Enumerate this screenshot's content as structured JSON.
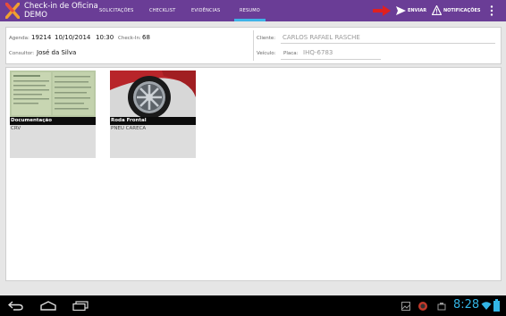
{
  "app": {
    "title_line1": "Check-in de Oficina",
    "title_line2": "DEMO",
    "bar_color": "#6a3d96"
  },
  "tabs": [
    {
      "label": "SOLICITAÇÕES"
    },
    {
      "label": "CHECKLIST"
    },
    {
      "label": "EVIDÊNCIAS"
    },
    {
      "label": "RESUMO",
      "active": true
    }
  ],
  "actions": {
    "enviar": "ENVIAR",
    "notificacoes": "NOTIFICAÇÕES"
  },
  "info": {
    "agenda_label": "Agenda:",
    "agenda_number": "19214",
    "agenda_date": "10/10/2014",
    "agenda_time": "10:30",
    "checkin_label": "Check-In:",
    "checkin_value": "68",
    "consultor_label": "Consultor:",
    "consultor_value": "José da Silva",
    "cliente_label": "Cliente:",
    "cliente_value": "CARLOS RAFAEL RASCHE",
    "veiculo_label": "Veículo:",
    "placa_label": "Placa:",
    "placa_value": "IHQ-6783"
  },
  "cards": [
    {
      "title": "Documentação",
      "description": "CRV"
    },
    {
      "title": "Roda Frontal",
      "description": "PNEU CARECA"
    }
  ],
  "system": {
    "time": "8:28"
  },
  "icons": [
    "app-logo-icon",
    "red-arrow-icon",
    "send-icon",
    "warning-icon",
    "overflow-menu-icon",
    "back-icon",
    "home-icon",
    "recent-apps-icon",
    "gallery-icon",
    "usb-icon",
    "wifi-icon",
    "battery-icon"
  ],
  "colors": {
    "accent": "#3fb3e8",
    "clock": "#33b5e5",
    "arrow": "#e02020"
  }
}
